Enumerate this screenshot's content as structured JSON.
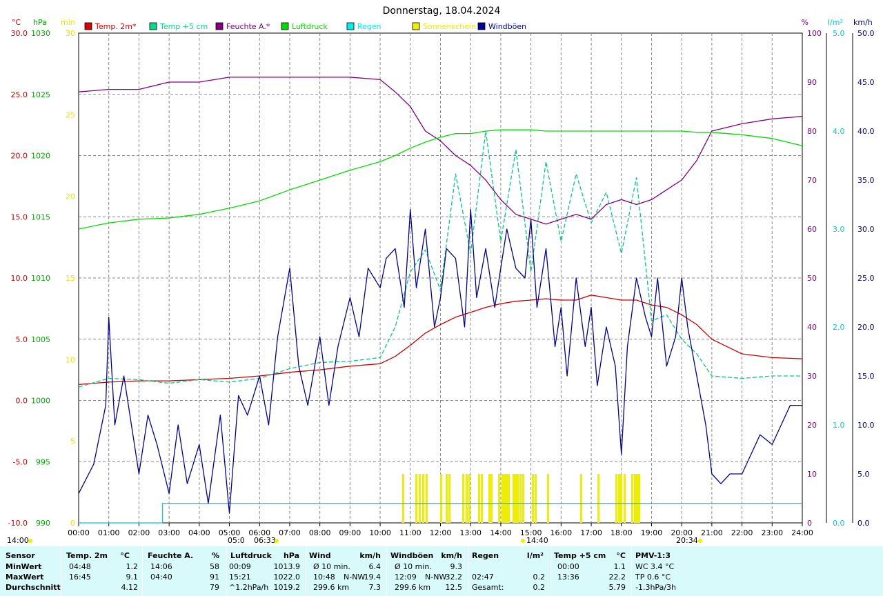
{
  "chart_data": {
    "type": "line",
    "title": "Donnerstag, 18.04.2024",
    "x_ticks": [
      "00:00",
      "01:00",
      "02:00",
      "03:00",
      "04:00",
      "05:00",
      "06:00",
      "07:00",
      "08:00",
      "09:00",
      "10:00",
      "11:00",
      "12:00",
      "13:00",
      "14:00",
      "15:00",
      "16:00",
      "17:00",
      "18:00",
      "19:00",
      "20:00",
      "21:00",
      "22:00",
      "23:00",
      "24:00"
    ],
    "axes": {
      "temp_c": {
        "unit": "°C",
        "color": "#cc0000",
        "range": [
          -10,
          30
        ],
        "ticks": [
          "-10.0",
          "-5.0",
          "0.0",
          "5.0",
          "10.0",
          "15.0",
          "20.0",
          "25.0",
          "30.0"
        ]
      },
      "pressure_hpa": {
        "unit": "hPa",
        "color": "#00aa00",
        "range": [
          990,
          1030
        ],
        "ticks": [
          "990",
          "995",
          "1000",
          "1005",
          "1010",
          "1015",
          "1020",
          "1025",
          "1030"
        ]
      },
      "sun_min": {
        "unit": "min",
        "color": "#e6e600",
        "range": [
          0,
          30
        ],
        "ticks": [
          "0",
          "5",
          "10",
          "15",
          "20",
          "25",
          "30"
        ]
      },
      "humidity_pct": {
        "unit": "%",
        "color": "#800080",
        "range": [
          0,
          100
        ],
        "ticks": [
          "0",
          "10",
          "20",
          "30",
          "40",
          "50",
          "60",
          "70",
          "80",
          "90",
          "100"
        ]
      },
      "rain_lm2": {
        "unit": "l/m²",
        "color": "#00cccc",
        "range": [
          0,
          5
        ],
        "ticks": [
          "0.0",
          "1.0",
          "2.0",
          "3.0",
          "4.0",
          "5.0"
        ]
      },
      "wind_kmh": {
        "unit": "km/h",
        "color": "#000080",
        "range": [
          0,
          50
        ],
        "ticks": [
          "0.0",
          "5.0",
          "10.0",
          "15.0",
          "20.0",
          "25.0",
          "30.0",
          "35.0",
          "40.0",
          "45.0",
          "50.0"
        ]
      }
    },
    "legend": [
      {
        "name": "Temp. 2m*",
        "color": "#dd0000"
      },
      {
        "name": "Temp +5 cm",
        "color": "#00dd88"
      },
      {
        "name": "Feuchte A.*",
        "color": "#800080"
      },
      {
        "name": "Luftdruck",
        "color": "#00dd00"
      },
      {
        "name": "Regen",
        "color": "#00eeee"
      },
      {
        "name": "Sonnenschein",
        "color": "#eeee00"
      },
      {
        "name": "Windböen",
        "color": "#000099"
      }
    ],
    "annotations": {
      "sun_events": [
        "14:00",
        "14:40",
        "20:34"
      ],
      "marks": [
        "05:0",
        "06:33"
      ]
    },
    "series": [
      {
        "name": "Temp. 2m*",
        "axis": "temp_c",
        "color": "#cc0000",
        "x": [
          0,
          1,
          2,
          3,
          4,
          5,
          6,
          7,
          8,
          9,
          10,
          10.5,
          11,
          11.5,
          12,
          12.5,
          13,
          13.5,
          14,
          14.5,
          15,
          15.5,
          16,
          16.5,
          17,
          17.5,
          18,
          18.5,
          19,
          19.5,
          20,
          20.5,
          21,
          22,
          23,
          24
        ],
        "y": [
          1.3,
          1.5,
          1.6,
          1.6,
          1.7,
          1.8,
          2.0,
          2.3,
          2.5,
          2.8,
          3.0,
          3.6,
          4.5,
          5.5,
          6.2,
          6.8,
          7.2,
          7.6,
          7.9,
          8.1,
          8.2,
          8.3,
          8.2,
          8.2,
          8.6,
          8.4,
          8.2,
          8.2,
          7.8,
          7.6,
          7.0,
          6.2,
          5.0,
          3.8,
          3.5,
          3.4
        ]
      },
      {
        "name": "Temp +5 cm",
        "axis": "temp_c",
        "color": "#00cc88",
        "dashed": true,
        "x": [
          0,
          1,
          2,
          3,
          4,
          5,
          6,
          7,
          8,
          9,
          10,
          10.5,
          11,
          11.5,
          12,
          12.5,
          13,
          13.5,
          14,
          14.5,
          15,
          15.5,
          16,
          16.5,
          17,
          17.5,
          18,
          18.5,
          19,
          19.5,
          20,
          20.5,
          21,
          22,
          23,
          24
        ],
        "y": [
          1.1,
          1.8,
          1.7,
          1.4,
          1.7,
          1.5,
          1.8,
          2.6,
          3.1,
          3.2,
          3.5,
          6.0,
          10.5,
          12.3,
          9.0,
          18.5,
          12.0,
          22.0,
          13.0,
          20.5,
          10.5,
          19.5,
          13.0,
          18.5,
          14.5,
          17.0,
          12.0,
          18.2,
          6.5,
          7.0,
          5.0,
          3.8,
          2.0,
          1.8,
          2.0,
          2.0
        ]
      },
      {
        "name": "Feuchte A.*",
        "axis": "humidity_pct",
        "color": "#800080",
        "x": [
          0,
          1,
          2,
          3,
          4,
          5,
          6,
          7,
          8,
          9,
          10,
          10.5,
          11,
          11.5,
          12,
          12.5,
          13,
          13.5,
          14,
          14.5,
          15,
          15.5,
          16,
          16.5,
          17,
          17.5,
          18,
          18.5,
          19,
          19.5,
          20,
          20.5,
          21,
          22,
          23,
          24
        ],
        "y": [
          88,
          88.5,
          88.5,
          90,
          90,
          91,
          91,
          91,
          91,
          91,
          90.5,
          88,
          85,
          80,
          78,
          75,
          73,
          70,
          66,
          63,
          62,
          61,
          62,
          63,
          62,
          65,
          66,
          65,
          66,
          68,
          70,
          74,
          80,
          81.5,
          82.5,
          83
        ]
      },
      {
        "name": "Luftdruck",
        "axis": "pressure_hpa",
        "color": "#00dd00",
        "x": [
          0,
          1,
          2,
          3,
          4,
          5,
          6,
          7,
          8,
          9,
          10,
          10.5,
          11,
          11.5,
          12,
          12.5,
          13,
          13.5,
          14,
          14.5,
          15,
          15.5,
          16,
          16.5,
          17,
          17.5,
          18,
          18.5,
          19,
          19.5,
          20,
          20.5,
          21,
          22,
          23,
          24
        ],
        "y": [
          1014.0,
          1014.5,
          1014.8,
          1014.9,
          1015.2,
          1015.7,
          1016.3,
          1017.2,
          1018.0,
          1018.8,
          1019.5,
          1020.0,
          1020.6,
          1021.1,
          1021.5,
          1021.8,
          1021.8,
          1022.0,
          1022.1,
          1022.1,
          1022.1,
          1022.0,
          1022.0,
          1022.0,
          1022.0,
          1022.0,
          1022.0,
          1022.0,
          1022.0,
          1022.0,
          1022.0,
          1021.9,
          1021.9,
          1021.7,
          1021.4,
          1020.8
        ]
      },
      {
        "name": "Windböen",
        "axis": "wind_kmh",
        "color": "#000099",
        "x": [
          0,
          0.5,
          0.9,
          1,
          1.2,
          1.5,
          2,
          2.3,
          2.6,
          3,
          3.3,
          3.6,
          4,
          4.3,
          4.7,
          5,
          5.3,
          5.6,
          6,
          6.3,
          6.6,
          7,
          7.3,
          7.6,
          8,
          8.3,
          8.6,
          9,
          9.3,
          9.6,
          10,
          10.2,
          10.5,
          10.8,
          11,
          11.2,
          11.5,
          11.8,
          12,
          12.2,
          12.5,
          12.8,
          13,
          13.2,
          13.5,
          13.8,
          14,
          14.2,
          14.5,
          14.8,
          15,
          15.2,
          15.5,
          15.8,
          16,
          16.2,
          16.5,
          16.8,
          17,
          17.2,
          17.5,
          17.8,
          18,
          18.2,
          18.5,
          18.8,
          19,
          19.2,
          19.5,
          19.8,
          20,
          20.2,
          20.5,
          20.8,
          21,
          21.3,
          21.6,
          22,
          22.3,
          22.6,
          23,
          23.3,
          23.6,
          24
        ],
        "y": [
          3,
          6,
          12,
          21,
          10,
          15,
          5,
          11,
          8,
          3,
          10,
          4,
          8,
          2,
          11,
          1,
          13,
          11,
          15,
          10,
          19,
          26,
          16,
          12,
          19,
          12,
          18,
          23,
          19,
          26,
          24,
          27,
          28,
          22,
          32,
          24,
          30,
          20,
          23,
          28,
          27,
          20,
          32,
          23,
          28,
          22,
          26,
          30,
          26,
          25,
          31,
          22,
          28,
          18,
          22,
          15,
          25,
          18,
          22,
          14,
          20,
          16,
          7,
          18,
          25,
          21,
          19,
          25,
          16,
          19,
          25,
          20,
          15,
          10,
          5,
          4,
          5,
          5,
          7,
          9,
          8,
          10,
          12,
          12
        ]
      }
    ]
  },
  "stats": {
    "headers": [
      {
        "label": "Sensor",
        "unit": ""
      },
      {
        "label": "Temp. 2m",
        "unit": "°C"
      },
      {
        "label": "Feuchte A.",
        "unit": "%"
      },
      {
        "label": "Luftdruck",
        "unit": "hPa"
      },
      {
        "label": "Wind",
        "unit": "km/h"
      },
      {
        "label": "Windböen",
        "unit": "km/h"
      },
      {
        "label": "Regen",
        "unit": "l/m²"
      },
      {
        "label": "Temp +5 cm",
        "unit": "°C"
      },
      {
        "label": "PMV-1:3",
        "unit": ""
      }
    ],
    "row_labels": [
      "MinWert",
      "MaxWert",
      "Durchschnitt"
    ],
    "temp2m": [
      [
        "04:48",
        "1.2"
      ],
      [
        "16:45",
        "9.1"
      ],
      [
        "",
        "4.12"
      ]
    ],
    "feuchte": [
      [
        "14:06",
        "58"
      ],
      [
        "04:40",
        "91"
      ],
      [
        "",
        "79"
      ]
    ],
    "luftdruck": [
      [
        "00:09",
        "1013.9"
      ],
      [
        "15:21",
        "1022.0"
      ],
      [
        "^1.2hPa/h",
        "1019.2"
      ]
    ],
    "wind": [
      [
        "Ø 10 min.",
        "",
        "6.4"
      ],
      [
        "10:48",
        "N-NW",
        "19.4"
      ],
      [
        "299.6 km",
        "",
        "7.3"
      ]
    ],
    "windboen": [
      [
        "Ø 10 min.",
        "",
        "9.3"
      ],
      [
        "12:09",
        "N-NW",
        "32.2"
      ],
      [
        "299.6 km",
        "",
        "12.5"
      ]
    ],
    "regen": [
      [
        "",
        ""
      ],
      [
        "02:47",
        "0.2"
      ],
      [
        "Gesamt:",
        "0.2"
      ]
    ],
    "temp5cm": [
      [
        "00:00",
        "1.1"
      ],
      [
        "13:36",
        "22.2"
      ],
      [
        "",
        "5.79"
      ]
    ],
    "pmv": [
      "WC 3.4 °C",
      "TP 0.6 °C",
      "-1.3hPa/3h"
    ]
  }
}
